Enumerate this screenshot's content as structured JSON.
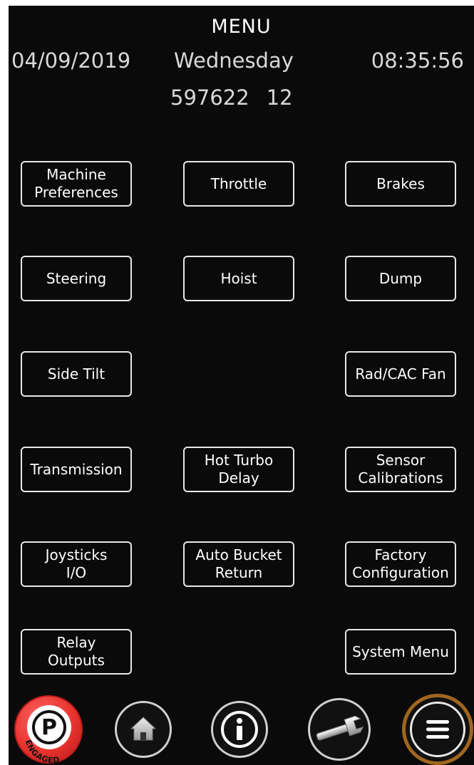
{
  "header": {
    "title": "MENU",
    "date": "04/09/2019",
    "day": "Wednesday",
    "time": "08:35:56",
    "machine_id": "597622",
    "code": "12"
  },
  "menu": {
    "machine_preferences": "Machine\nPreferences",
    "throttle": "Throttle",
    "brakes": "Brakes",
    "steering": "Steering",
    "hoist": "Hoist",
    "dump": "Dump",
    "side_tilt": "Side Tilt",
    "rad_cac_fan": "Rad/CAC Fan",
    "transmission": "Transmission",
    "hot_turbo_delay": "Hot Turbo\nDelay",
    "sensor_calibrations": "Sensor\nCalibrations",
    "joysticks_io": "Joysticks\nI/O",
    "auto_bucket_return": "Auto Bucket\nReturn",
    "factory_configuration": "Factory\nConfiguration",
    "relay_outputs": "Relay\nOutputs",
    "system_menu": "System Menu"
  },
  "bottom_nav": {
    "park_label": "P",
    "park_status": "ENGAGED",
    "icons": [
      "park-brake-icon",
      "home-icon",
      "info-icon",
      "wrench-icon",
      "hamburger-menu-icon"
    ],
    "colors": {
      "park_red": "#e8332e",
      "menu_ring": "#a0661f",
      "screen_bg": "#0a0a0a"
    }
  }
}
